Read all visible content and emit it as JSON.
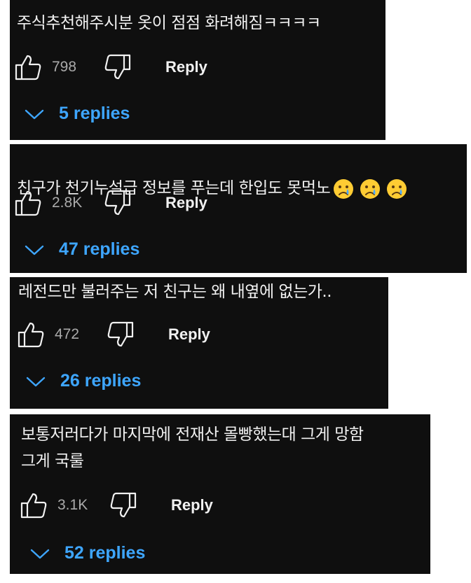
{
  "comments": [
    {
      "text": "주식추천해주시분 옷이 점점 화려해짐ㅋㅋㅋㅋ",
      "likes": "798",
      "reply_label": "Reply",
      "replies_label": "5 replies"
    },
    {
      "text": "친구가 천기누설급 정보를 푸는데 한입도 못먹노",
      "emojis": [
        "crying-face",
        "crying-face",
        "crying-face"
      ],
      "likes": "2.8K",
      "reply_label": "Reply",
      "replies_label": "47 replies"
    },
    {
      "text": "레전드만 불러주는 저 친구는 왜 내옆에 없는가..",
      "likes": "472",
      "reply_label": "Reply",
      "replies_label": "26 replies"
    },
    {
      "text": "보통저러다가 마지막에 전재산 몰빵했는대 그게 망함\n그게 국룰",
      "likes": "3.1K",
      "reply_label": "Reply",
      "replies_label": "52 replies"
    }
  ],
  "colors": {
    "background": "#0f0f0f",
    "text": "#f1f1f1",
    "muted": "#aaaaaa",
    "link": "#3ea6ff"
  }
}
